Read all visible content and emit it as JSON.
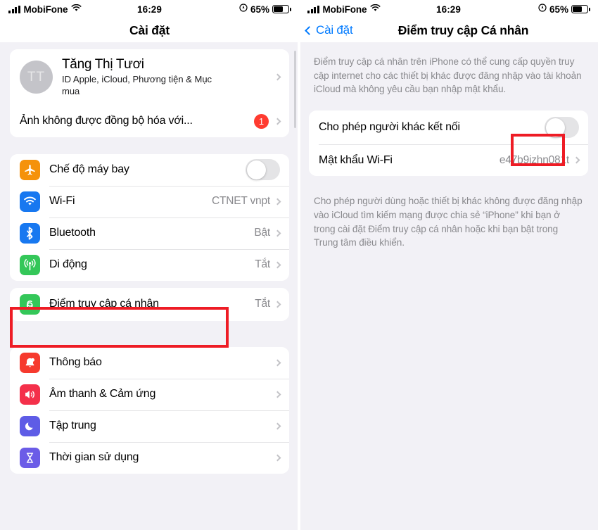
{
  "left_phone": {
    "status_bar": {
      "carrier": "MobiFone",
      "time": "16:29",
      "battery_percent": "65%",
      "signal_icon": "signal-bars-icon",
      "wifi_icon": "wifi-icon",
      "location_icon": "location-services-icon",
      "battery_icon": "battery-icon"
    },
    "nav": {
      "title": "Cài đặt"
    },
    "account": {
      "initials": "TT",
      "name": "Tăng Thị Tươi",
      "subtitle": "ID Apple, iCloud, Phương tiện & Mục mua",
      "chevron_icon": "chevron-right-icon"
    },
    "alert_row": {
      "label": "Ảnh không được đồng bộ hóa với...",
      "badge": "1",
      "chevron_icon": "chevron-right-icon"
    },
    "group_connectivity": [
      {
        "label": "Chế độ máy bay",
        "icon": "airplane-icon",
        "control": "toggle",
        "toggle_on": false,
        "value": ""
      },
      {
        "label": "Wi-Fi",
        "icon": "wifi-icon",
        "control": "chevron",
        "value": "CTNET vnpt"
      },
      {
        "label": "Bluetooth",
        "icon": "bluetooth-icon",
        "control": "chevron",
        "value": "Bật"
      },
      {
        "label": "Di động",
        "icon": "cellular-icon",
        "control": "chevron",
        "value": "Tắt"
      }
    ],
    "group_hotspot": [
      {
        "label": "Điểm truy cập cá nhân",
        "icon": "personal-hotspot-icon",
        "control": "chevron",
        "value": "Tắt",
        "highlighted": true
      }
    ],
    "group_system": [
      {
        "label": "Thông báo",
        "icon": "notifications-icon",
        "control": "chevron",
        "value": ""
      },
      {
        "label": "Âm thanh & Cảm ứng",
        "icon": "sounds-haptics-icon",
        "control": "chevron",
        "value": ""
      },
      {
        "label": "Tập trung",
        "icon": "focus-icon",
        "control": "chevron",
        "value": ""
      },
      {
        "label": "Thời gian sử dụng",
        "icon": "screen-time-icon",
        "control": "chevron",
        "value": ""
      }
    ]
  },
  "right_phone": {
    "status_bar": {
      "carrier": "MobiFone",
      "time": "16:29",
      "battery_percent": "65%",
      "signal_icon": "signal-bars-icon",
      "wifi_icon": "wifi-icon",
      "location_icon": "location-services-icon",
      "battery_icon": "battery-icon"
    },
    "nav": {
      "back_label": "Cài đặt",
      "back_icon": "chevron-left-icon",
      "title": "Điểm truy cập Cá nhân"
    },
    "intro_text": "Điểm truy cập cá nhân trên iPhone có thể cung cấp quyền truy cập internet cho các thiết bị khác được đăng nhập vào tài khoản iCloud mà không yêu cầu bạn nhập mật khẩu.",
    "rows": [
      {
        "label": "Cho phép người khác kết nối",
        "control": "toggle",
        "toggle_on": false,
        "value": "",
        "highlighted": true
      },
      {
        "label": "Mật khẩu Wi-Fi",
        "control": "chevron",
        "value": "e47b9izhn081t",
        "highlighted": false
      }
    ],
    "footer_text": "Cho phép người dùng hoặc thiết bị khác không được đăng nhập vào iCloud tìm kiếm mạng được chia sẻ “iPhone” khi bạn ở trong cài đặt Điểm truy cập cá nhân hoặc khi bạn bật trong Trung tâm điều khiển."
  },
  "colors": {
    "accent_blue": "#007aff",
    "highlight_red": "#ee1c25",
    "badge_red": "#ff3b30",
    "secondary_text": "#8a8a8e",
    "page_background": "#f2f1f6"
  }
}
